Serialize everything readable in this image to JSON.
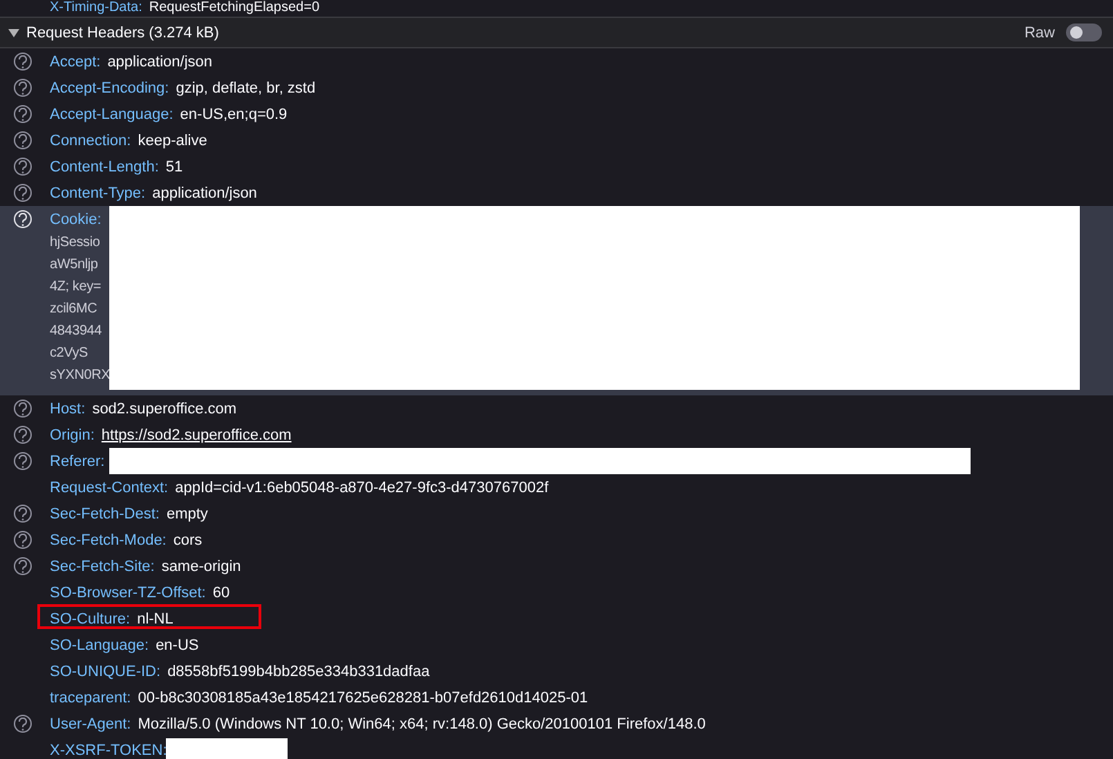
{
  "previous_row": {
    "name": "X-Timing-Data:",
    "value": "RequestFetchingElapsed=0"
  },
  "section": {
    "title": "Request Headers (3.274 kB)",
    "expanded": true,
    "raw_label": "Raw",
    "raw_on": false
  },
  "headers": [
    {
      "name": "Accept:",
      "value": "application/json",
      "help": true,
      "selected": false
    },
    {
      "name": "Accept-Encoding:",
      "value": "gzip, deflate, br, zstd",
      "help": true,
      "selected": false
    },
    {
      "name": "Accept-Language:",
      "value": "en-US,en;q=0.9",
      "help": true,
      "selected": false
    },
    {
      "name": "Connection:",
      "value": "keep-alive",
      "help": true,
      "selected": false
    },
    {
      "name": "Content-Length:",
      "value": "51",
      "help": true,
      "selected": false
    },
    {
      "name": "Content-Type:",
      "value": "application/json",
      "help": true,
      "selected": false
    },
    {
      "name": "Cookie:",
      "kind": "multiline",
      "lines": [
        "hjSessio",
        "aW5nljp",
        "4Z; key=",
        "zcil6MC",
        "4843944",
        "c2VyS",
        "sYXN0RX"
      ],
      "redacted": true,
      "help": true,
      "selected": true
    },
    {
      "name": "Host:",
      "value": "sod2.superoffice.com",
      "help": true,
      "selected": false
    },
    {
      "name": "Origin:",
      "kind": "link",
      "value": "https://sod2.superoffice.com",
      "help": true,
      "selected": false
    },
    {
      "name": "Referer:",
      "redacted": true,
      "help": true,
      "selected": false
    },
    {
      "name": "Request-Context:",
      "value": "appId=cid-v1:6eb05048-a870-4e27-9fc3-d4730767002f",
      "help": false,
      "selected": false
    },
    {
      "name": "Sec-Fetch-Dest:",
      "value": "empty",
      "help": true,
      "selected": false
    },
    {
      "name": "Sec-Fetch-Mode:",
      "value": "cors",
      "help": true,
      "selected": false
    },
    {
      "name": "Sec-Fetch-Site:",
      "value": "same-origin",
      "help": true,
      "selected": false
    },
    {
      "name": "SO-Browser-TZ-Offset:",
      "value": "60",
      "help": false,
      "selected": false
    },
    {
      "name": "SO-Culture:",
      "value": "nl-NL",
      "help": false,
      "selected": false,
      "highlighted": true
    },
    {
      "name": "SO-Language:",
      "value": "en-US",
      "help": false,
      "selected": false
    },
    {
      "name": "SO-UNIQUE-ID:",
      "value": "d8558bf5199b4bb285e334b331dadfaa",
      "help": false,
      "selected": false
    },
    {
      "name": "traceparent:",
      "value": "00-b8c30308185a43e1854217625e628281-b07efd2610d14025-01",
      "help": false,
      "selected": false
    },
    {
      "name": "User-Agent:",
      "value": "Mozilla/5.0 (Windows NT 10.0; Win64; x64; rv:148.0) Gecko/20100101 Firefox/148.0",
      "help": true,
      "selected": false
    },
    {
      "name": "X-XSRF-TOKEN:",
      "redacted": true,
      "help": false,
      "selected": false
    }
  ]
}
